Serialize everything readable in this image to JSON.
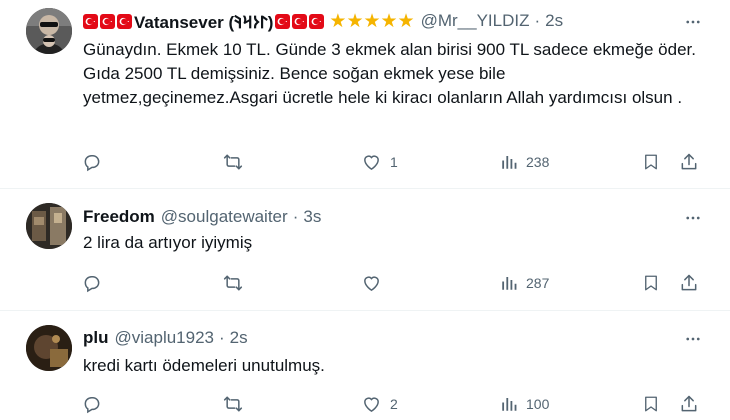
{
  "tweets": [
    {
      "name": "Vatansever (𐰃𐰆𐰺𐰚)",
      "flags_before": 3,
      "flags_after": 3,
      "stars": "★★★★★",
      "handle": "@Mr__YILDIZ",
      "separator": "·",
      "time": "2s",
      "text": "Günaydın. Ekmek 10 TL. Günde 3 ekmek alan birisi 900 TL sadece ekmeğe öder. Gıda 2500 TL demişsiniz. Bence soğan ekmek yese bile yetmez,geçinemez.Asgari ücretle hele ki kiracı olanların Allah yardımcısı olsun .",
      "reply_count": "",
      "retweet_count": "",
      "like_count": "1",
      "view_count": "238"
    },
    {
      "name": "Freedom",
      "handle": "@soulgatewaiter",
      "separator": "·",
      "time": "3s",
      "text": "2 lira da artıyor iyiymiş",
      "reply_count": "",
      "retweet_count": "",
      "like_count": "",
      "view_count": "287"
    },
    {
      "name": "plu",
      "handle": "@viaplu1923",
      "separator": "·",
      "time": "2s",
      "text": "kredi kartı ödemeleri unutulmuş.",
      "reply_count": "",
      "retweet_count": "",
      "like_count": "2",
      "view_count": "100"
    }
  ],
  "icons": {
    "reply": "reply-icon",
    "retweet": "retweet-icon",
    "like": "like-icon",
    "views": "views-icon",
    "bookmark": "bookmark-icon",
    "share": "share-icon",
    "more": "more-icon"
  },
  "colors": {
    "text": "#0f1419",
    "secondary": "#536471",
    "star": "#f5b400",
    "flag": "#e30a17",
    "divider": "#eff3f4"
  }
}
